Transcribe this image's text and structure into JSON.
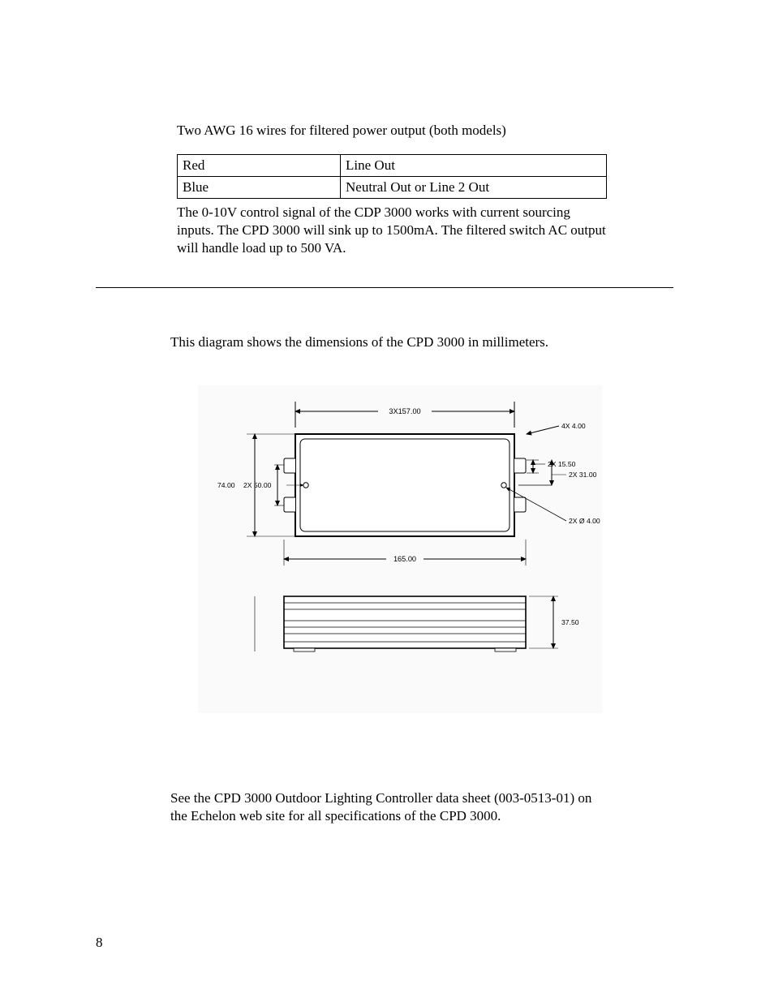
{
  "intro": "Two AWG 16 wires for filtered power output (both models)",
  "table": {
    "row1": {
      "color": "Red",
      "desc": "Line Out"
    },
    "row2": {
      "color": "Blue",
      "desc": "Neutral Out or Line 2 Out"
    }
  },
  "para1": "The 0-10V control signal of the CDP 3000 works with current sourcing inputs. The CPD 3000 will sink up to 1500mA.  The filtered switch AC output will handle load up to 500 VA.",
  "dimensions_intro": "This diagram shows the dimensions of the CPD 3000 in millimeters.",
  "diagram": {
    "dim_3x157": "3X157.00",
    "dim_4x4": "4X 4.00",
    "dim_2x1550": "2X 15.50",
    "dim_2x31": "2X 31.00",
    "dim_2x_dia4": "2X Ø 4.00",
    "dim_74": "74.00",
    "dim_2x50": "2X 50.00",
    "dim_165": "165.00",
    "dim_37_5": "37.50"
  },
  "reference": "See the CPD 3000 Outdoor Lighting Controller data sheet (003-0513-01) on the Echelon web site for all specifications of the CPD 3000.",
  "page_number": "8"
}
